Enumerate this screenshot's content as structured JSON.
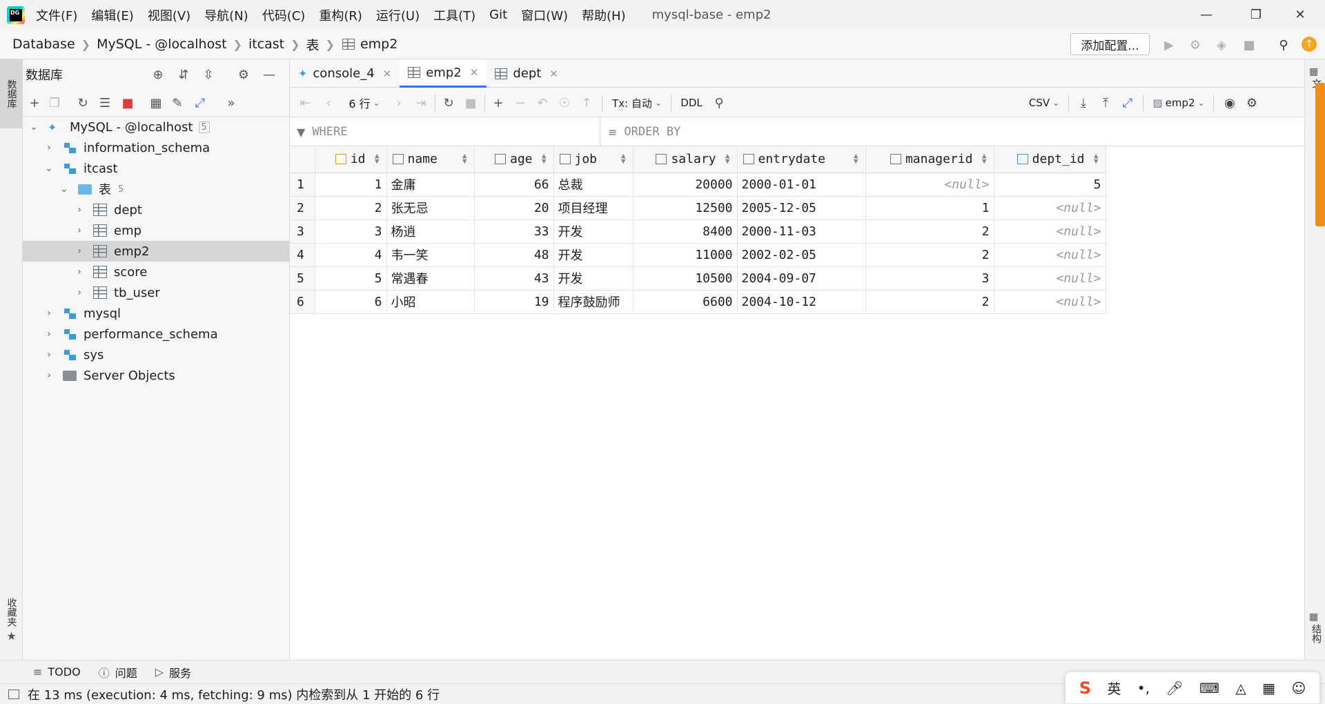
{
  "titlebar": {
    "menus": [
      "文件(F)",
      "编辑(E)",
      "视图(V)",
      "导航(N)",
      "代码(C)",
      "重构(R)",
      "运行(U)",
      "工具(T)",
      "Git",
      "窗口(W)",
      "帮助(H)"
    ],
    "window_title": "mysql-base - emp2"
  },
  "breadcrumb": [
    "Database",
    "MySQL - @localhost",
    "itcast",
    "表",
    "emp2"
  ],
  "navbar": {
    "add_config": "添加配置..."
  },
  "left_stripe": {
    "db_label": "数据库",
    "fav_label": "收藏夹"
  },
  "db_panel": {
    "title": "数据库",
    "tree": {
      "root": {
        "label": "MySQL - @localhost",
        "count": "5"
      },
      "information_schema": "information_schema",
      "itcast": "itcast",
      "tables_folder": {
        "label": "表",
        "count": "5"
      },
      "tables": [
        "dept",
        "emp",
        "emp2",
        "score",
        "tb_user"
      ],
      "mysql": "mysql",
      "performance_schema": "performance_schema",
      "sys": "sys",
      "server_objects": "Server Objects"
    }
  },
  "tabs": [
    "console_4",
    "emp2",
    "dept"
  ],
  "grid_toolbar": {
    "rows": "6 行",
    "tx": "Tx: 自动",
    "ddl": "DDL",
    "export": "CSV",
    "session": "emp2"
  },
  "filter": {
    "where": "WHERE",
    "order_by": "ORDER BY"
  },
  "grid": {
    "columns": [
      "id",
      "name",
      "age",
      "job",
      "salary",
      "entrydate",
      "managerid",
      "dept_id"
    ],
    "rows": [
      {
        "n": "1",
        "id": "1",
        "name": "金庸",
        "age": "66",
        "job": "总裁",
        "salary": "20000",
        "entrydate": "2000-01-01",
        "managerid": "<null>",
        "dept_id": "5"
      },
      {
        "n": "2",
        "id": "2",
        "name": "张无忌",
        "age": "20",
        "job": "项目经理",
        "salary": "12500",
        "entrydate": "2005-12-05",
        "managerid": "1",
        "dept_id": "<null>"
      },
      {
        "n": "3",
        "id": "3",
        "name": "杨逍",
        "age": "33",
        "job": "开发",
        "salary": "8400",
        "entrydate": "2000-11-03",
        "managerid": "2",
        "dept_id": "<null>"
      },
      {
        "n": "4",
        "id": "4",
        "name": "韦一笑",
        "age": "48",
        "job": "开发",
        "salary": "11000",
        "entrydate": "2002-02-05",
        "managerid": "2",
        "dept_id": "<null>"
      },
      {
        "n": "5",
        "id": "5",
        "name": "常遇春",
        "age": "43",
        "job": "开发",
        "salary": "10500",
        "entrydate": "2004-09-07",
        "managerid": "3",
        "dept_id": "<null>"
      },
      {
        "n": "6",
        "id": "6",
        "name": "小昭",
        "age": "19",
        "job": "程序鼓励师",
        "salary": "6600",
        "entrydate": "2004-10-12",
        "managerid": "2",
        "dept_id": "<null>"
      }
    ]
  },
  "bottom_tools": [
    "TODO",
    "问题",
    "服务"
  ],
  "status": {
    "text": "在 13 ms (execution: 4 ms, fetching: 9 ms) 内检索到从 1 开始的 6 行"
  },
  "ime": {
    "lang": "英"
  },
  "right_stripe": {
    "top_label": "文",
    "structure_label": "结构"
  },
  "colors": {
    "accent": "#3574f0",
    "selection": "#d5d5d5",
    "scroll_marker": "#f08c1a",
    "error_red": "#db3b3b"
  }
}
